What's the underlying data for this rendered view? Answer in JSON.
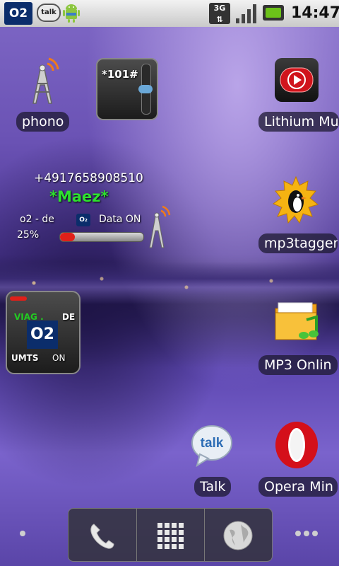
{
  "status_bar": {
    "carrier_icon": "O2",
    "talk_icon": "talk",
    "network_type": "3G",
    "time": "14:47"
  },
  "home": {
    "shortcuts": [
      {
        "label": "phono",
        "icon": "antenna-icon"
      },
      {
        "label": "Lithium Mu",
        "icon": "play-icon"
      },
      {
        "label": "mp3tagger",
        "icon": "penguin-icon"
      },
      {
        "label": "MP3 Onlin",
        "icon": "folder-music-icon"
      },
      {
        "label": "Talk",
        "icon": "talk-icon"
      },
      {
        "label": "Opera Min",
        "icon": "opera-icon"
      }
    ],
    "ussd_widget": {
      "code": "*101#"
    },
    "info_widget": {
      "phone_number": "+4917658908510",
      "name": "*Maez*",
      "operator": "o2 - de",
      "data_status": "Data ON",
      "battery_percent_text": "25%",
      "data_level": 0.18
    },
    "o2_widget": {
      "top_left": "VIAG .",
      "top_right": "DE",
      "logo": "O2",
      "bottom_left": "UMTS",
      "bottom_right": "ON"
    }
  },
  "colors": {
    "name_green": "#2ee22e",
    "viag_green": "#22cc22",
    "opera_red": "#d4101a",
    "data_bar_red": "#e0201a"
  }
}
